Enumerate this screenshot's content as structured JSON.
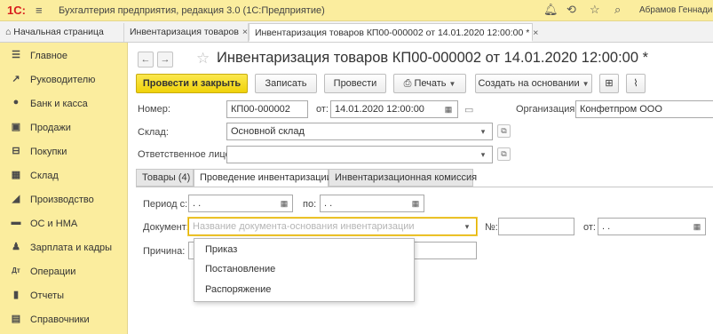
{
  "app": {
    "logo": "1С:",
    "title": "Бухгалтерия предприятия, редакция 3.0  (1С:Предприятие)",
    "user": "Абрамов Геннадий Се"
  },
  "tabs": [
    {
      "label": "Начальная страница"
    },
    {
      "label": "Инвентаризация товаров",
      "close": "×"
    },
    {
      "label": "Инвентаризация товаров КП00-000002 от 14.01.2020 12:00:00 *",
      "close": "×"
    }
  ],
  "sidebar": {
    "items": [
      {
        "label": "Главное",
        "icon": "menu-icon"
      },
      {
        "label": "Руководителю",
        "icon": "trend-icon"
      },
      {
        "label": "Банк и касса",
        "icon": "coin-icon"
      },
      {
        "label": "Продажи",
        "icon": "bag-icon"
      },
      {
        "label": "Покупки",
        "icon": "cart-icon"
      },
      {
        "label": "Склад",
        "icon": "warehouse-icon"
      },
      {
        "label": "Производство",
        "icon": "factory-icon"
      },
      {
        "label": "ОС и НМА",
        "icon": "truck-icon"
      },
      {
        "label": "Зарплата и кадры",
        "icon": "person-icon"
      },
      {
        "label": "Операции",
        "icon": "operations-icon"
      },
      {
        "label": "Отчеты",
        "icon": "bar-chart-icon"
      },
      {
        "label": "Справочники",
        "icon": "book-icon"
      }
    ]
  },
  "document": {
    "title": "Инвентаризация товаров КП00-000002 от 14.01.2020 12:00:00 *"
  },
  "toolbar": {
    "post_close": "Провести и закрыть",
    "save": "Записать",
    "post": "Провести",
    "print": "Печать",
    "create_based": "Создать на основании"
  },
  "form": {
    "number_label": "Номер:",
    "number_value": "КП00-000002",
    "date_label": "от:",
    "date_value": "14.01.2020 12:00:00",
    "org_label": "Организация:",
    "org_value": "Конфетпром ООО",
    "warehouse_label": "Склад:",
    "warehouse_value": "Основной склад",
    "responsible_label": "Ответственное лицо:",
    "responsible_value": ""
  },
  "form_tabs": [
    {
      "label": "Товары (4)"
    },
    {
      "label": "Проведение инвентаризации"
    },
    {
      "label": "Инвентаризационная комиссия"
    }
  ],
  "inventory": {
    "period_label": "Период с:",
    "period_from": " .  .",
    "period_to_label": "по:",
    "period_to": " .  .",
    "document_label": "Документ:",
    "document_placeholder": "Название документа-основания инвентаризации",
    "num_label": "№:",
    "num_value": "",
    "from_label": "от:",
    "from_value": " .  .",
    "reason_label": "Причина:",
    "reason_value": ""
  },
  "dropdown": {
    "options": [
      "Приказ",
      "Постановление",
      "Распоряжение"
    ]
  }
}
